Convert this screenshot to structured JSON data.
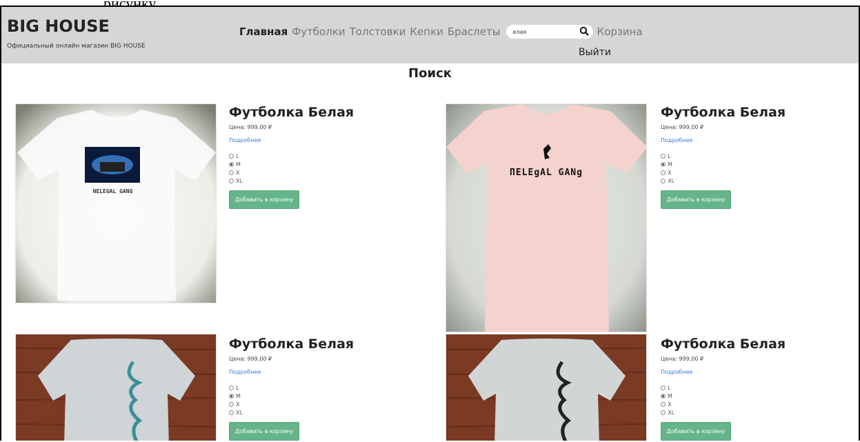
{
  "caption": "рисунку",
  "header": {
    "title": "BIG HOUSE",
    "tagline": "Официальный онлайн магазин BIG HOUSE",
    "nav": [
      "Главная",
      "Футболки",
      "Толстовки",
      "Кепки",
      "Браслеты"
    ],
    "search_value": "елая",
    "cart": "Корзина",
    "logout": "Выйти"
  },
  "page_title": "Поиск",
  "products": [
    {
      "title": "Футболка Белая",
      "price": "Цена: 999,00 ₽",
      "more": "Подробнее",
      "sizes": [
        "L",
        "M",
        "X",
        "XL"
      ],
      "selected": "M",
      "button": "Добавить в корзину",
      "print_text": "NELEGAL GANG"
    },
    {
      "title": "Футболка Белая",
      "price": "Цена: 999,00 ₽",
      "more": "Подробнее",
      "sizes": [
        "L",
        "M",
        "X",
        "XL"
      ],
      "selected": "M",
      "button": "Добавить в корзину",
      "print_text": "ПELEgAL GANg"
    },
    {
      "title": "Футболка Белая",
      "price": "Цена: 999,00 ₽",
      "more": "Подробнее",
      "sizes": [
        "L",
        "M",
        "X",
        "XL"
      ],
      "selected": "M",
      "button": "Добавить в корзину"
    },
    {
      "title": "Футболка Белая",
      "price": "Цена: 999,00 ₽",
      "more": "Подробнее",
      "sizes": [
        "L",
        "M",
        "X",
        "XL"
      ],
      "selected": "M",
      "button": "Добавить в корзину"
    }
  ],
  "colors": {
    "header_bg": "#d6d6d6",
    "button": "#66b58a",
    "link": "#3a7ad8"
  }
}
